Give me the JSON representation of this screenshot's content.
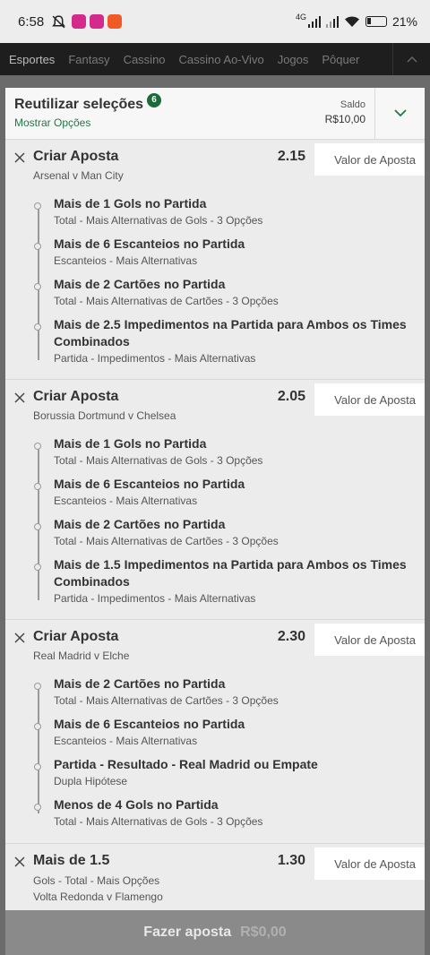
{
  "status_bar": {
    "time": "6:58",
    "network": "4G",
    "battery": "21%"
  },
  "nav": {
    "items": [
      "Esportes",
      "Fantasy",
      "Cassino",
      "Cassino Ao-Vivo",
      "Jogos",
      "Pôquer"
    ]
  },
  "slip": {
    "title": "Reutilizar seleções",
    "count": "6",
    "show_options": "Mostrar Opções",
    "saldo_label": "Saldo",
    "saldo_value": "R$10,00"
  },
  "bets": [
    {
      "title": "Criar Aposta",
      "match": "Arsenal v Man City",
      "odds": "2.15",
      "stake_placeholder": "Valor de Aposta",
      "legs": [
        {
          "name": "Mais de 1 Gols no Partida",
          "market": "Total - Mais Alternativas de Gols - 3 Opções"
        },
        {
          "name": "Mais de 6 Escanteios no Partida",
          "market": "Escanteios - Mais Alternativas"
        },
        {
          "name": "Mais de 2 Cartões no Partida",
          "market": "Total - Mais Alternativas de Cartões - 3 Opções"
        },
        {
          "name": "Mais de 2.5 Impedimentos na Partida para Ambos os Times Combinados",
          "market": "Partida - Impedimentos - Mais Alternativas"
        }
      ]
    },
    {
      "title": "Criar Aposta",
      "match": "Borussia Dortmund v Chelsea",
      "odds": "2.05",
      "stake_placeholder": "Valor de Aposta",
      "legs": [
        {
          "name": "Mais de 1 Gols no Partida",
          "market": "Total - Mais Alternativas de Gols - 3 Opções"
        },
        {
          "name": "Mais de 6 Escanteios no Partida",
          "market": "Escanteios - Mais Alternativas"
        },
        {
          "name": "Mais de 2 Cartões no Partida",
          "market": "Total - Mais Alternativas de Cartões - 3 Opções"
        },
        {
          "name": "Mais de 1.5 Impedimentos na Partida para Ambos os Times Combinados",
          "market": "Partida - Impedimentos - Mais Alternativas"
        }
      ]
    },
    {
      "title": "Criar Aposta",
      "match": "Real Madrid v Elche",
      "odds": "2.30",
      "stake_placeholder": "Valor de Aposta",
      "legs": [
        {
          "name": "Mais de 2 Cartões no Partida",
          "market": "Total - Mais Alternativas de Cartões - 3 Opções"
        },
        {
          "name": "Mais de 6 Escanteios no Partida",
          "market": "Escanteios - Mais Alternativas"
        },
        {
          "name": "Partida - Resultado - Real Madrid ou Empate",
          "market": "Dupla Hipótese"
        },
        {
          "name": "Menos de 4 Gols no Partida",
          "market": "Total - Mais Alternativas de Gols - 3 Opções"
        }
      ]
    }
  ],
  "single": {
    "title": "Mais de 1.5",
    "odds": "1.30",
    "market": "Gols - Total - Mais Opções",
    "match": "Volta Redonda v Flamengo",
    "stake_placeholder": "Valor de Aposta"
  },
  "place_bet": {
    "label": "Fazer aposta",
    "amount": "R$0,00"
  }
}
